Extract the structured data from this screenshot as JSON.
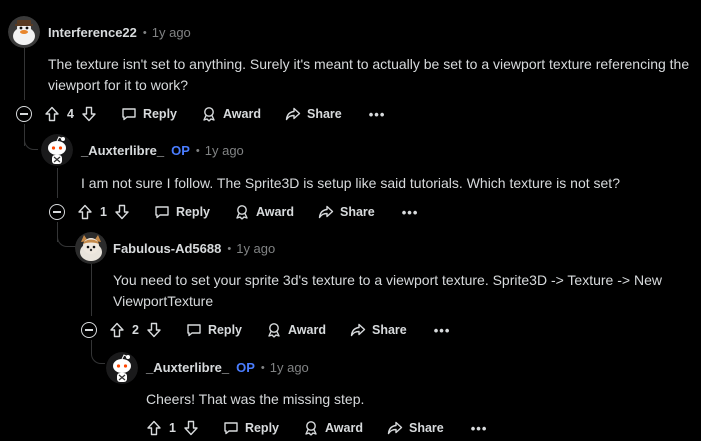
{
  "comments": [
    {
      "author": "Interference22",
      "op": "",
      "time": "1y ago",
      "body": "The texture isn't set to anything. Surely it's meant to actually be set to a viewport texture referencing the viewport for it to work?",
      "votes": "4",
      "avatar": "duck-avatar"
    },
    {
      "author": "_Auxterlibre_",
      "op": "OP",
      "time": "1y ago",
      "body": "I am not sure I follow. The Sprite3D is setup like said tutorials. Which texture is not set?",
      "votes": "1",
      "avatar": "snoo-avatar"
    },
    {
      "author": "Fabulous-Ad5688",
      "op": "",
      "time": "1y ago",
      "body": "You need to set your sprite 3d's texture to a viewport texture. Sprite3D -> Texture -> New ViewportTexture",
      "votes": "2",
      "avatar": "fox-avatar"
    },
    {
      "author": "_Auxterlibre_",
      "op": "OP",
      "time": "1y ago",
      "body": "Cheers! That was the missing step.",
      "votes": "1",
      "avatar": "snoo-avatar"
    }
  ],
  "actions": {
    "reply": "Reply",
    "award": "Award",
    "share": "Share",
    "more": "•••"
  },
  "colors": {
    "background": "#000000",
    "text": "#d7dadc",
    "muted": "#818384",
    "op": "#4a7dff",
    "thread": "#343536"
  }
}
